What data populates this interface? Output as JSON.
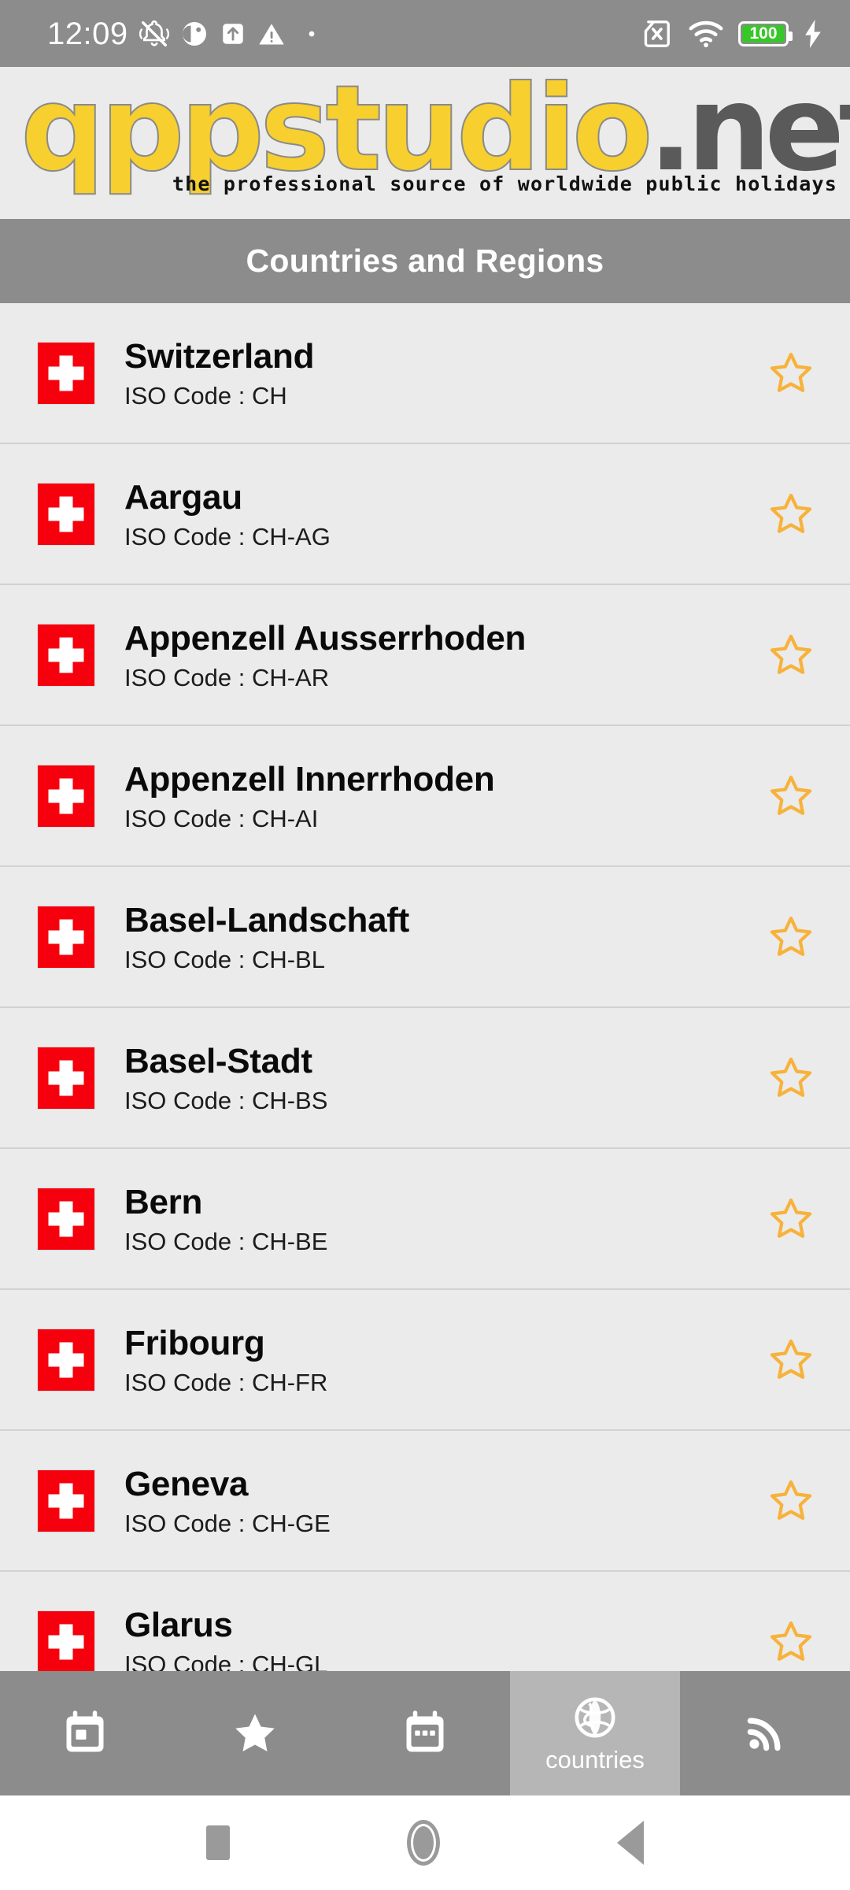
{
  "status_bar": {
    "time": "12:09",
    "left_icons": [
      "silent-bell-icon",
      "do-not-disturb-icon",
      "upload-arrow-icon",
      "warning-triangle-icon",
      "dot-icon"
    ],
    "right_icons": [
      "no-sim-icon",
      "wifi-icon",
      "battery-icon",
      "charging-bolt-icon"
    ],
    "battery_level": "100"
  },
  "logo": {
    "name_part_1": "qppstudio",
    "name_part_2": ".net",
    "tagline": "the professional source of worldwide public holidays"
  },
  "header": {
    "title": "Countries and Regions"
  },
  "list": {
    "iso_label": "ISO Code :",
    "items": [
      {
        "name": "Switzerland",
        "iso": "ISO Code : CH",
        "flag": "swiss-flag",
        "starred": false
      },
      {
        "name": "Aargau",
        "iso": "ISO Code : CH-AG",
        "flag": "swiss-flag",
        "starred": false
      },
      {
        "name": "Appenzell Ausserrhoden",
        "iso": "ISO Code : CH-AR",
        "flag": "swiss-flag",
        "starred": false
      },
      {
        "name": "Appenzell Innerrhoden",
        "iso": "ISO Code : CH-AI",
        "flag": "swiss-flag",
        "starred": false
      },
      {
        "name": "Basel-Landschaft",
        "iso": "ISO Code : CH-BL",
        "flag": "swiss-flag",
        "starred": false
      },
      {
        "name": "Basel-Stadt",
        "iso": "ISO Code : CH-BS",
        "flag": "swiss-flag",
        "starred": false
      },
      {
        "name": "Bern",
        "iso": "ISO Code : CH-BE",
        "flag": "swiss-flag",
        "starred": false
      },
      {
        "name": "Fribourg",
        "iso": "ISO Code : CH-FR",
        "flag": "swiss-flag",
        "starred": false
      },
      {
        "name": "Geneva",
        "iso": "ISO Code : CH-GE",
        "flag": "swiss-flag",
        "starred": false
      },
      {
        "name": "Glarus",
        "iso": "ISO Code : CH-GL",
        "flag": "swiss-flag",
        "starred": false
      }
    ]
  },
  "tabbar": {
    "tabs": [
      {
        "icon": "calendar-today-icon",
        "label": "",
        "active": false
      },
      {
        "icon": "star-filled-icon",
        "label": "",
        "active": false
      },
      {
        "icon": "calendar-events-icon",
        "label": "",
        "active": false
      },
      {
        "icon": "globe-icon",
        "label": "countries",
        "active": true
      },
      {
        "icon": "rss-feed-icon",
        "label": "",
        "active": false
      }
    ]
  },
  "android_nav": {
    "recents": "recents-square-icon",
    "home": "home-circle-icon",
    "back": "back-triangle-icon"
  },
  "colors": {
    "bar_gray": "#8c8c8c",
    "tab_active_gray": "#b6b6b6",
    "list_bg": "#ebebeb",
    "divider": "#d2d2d2",
    "flag_red": "#f5000c",
    "star_amber": "#f7b23b",
    "logo_yellow": "#f7cf2e",
    "logo_dark": "#5a5a5a",
    "battery_green": "#39c62b"
  }
}
